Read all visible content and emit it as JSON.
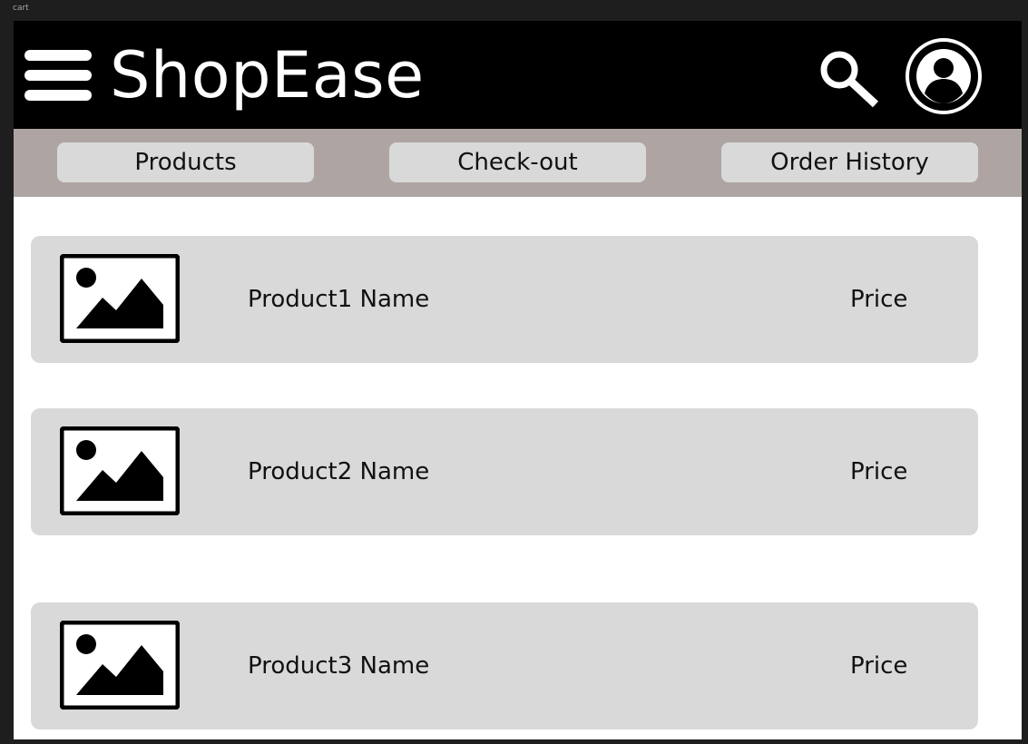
{
  "frame": {
    "label": "cart"
  },
  "header": {
    "brand": "ShopEase",
    "icons": {
      "menu": "hamburger-menu-icon",
      "search": "search-icon",
      "profile": "user-profile-icon"
    }
  },
  "nav": {
    "items": [
      {
        "label": "Products"
      },
      {
        "label": "Check-out"
      },
      {
        "label": "Order History"
      }
    ]
  },
  "cart": {
    "items": [
      {
        "name": "Product1 Name",
        "price": "Price",
        "image": "image-placeholder-icon"
      },
      {
        "name": "Product2 Name",
        "price": "Price",
        "image": "image-placeholder-icon"
      },
      {
        "name": "Product3 Name",
        "price": "Price",
        "image": "image-placeholder-icon"
      }
    ]
  },
  "colors": {
    "header_bg": "#000000",
    "nav_bg": "#aea5a3",
    "button_bg": "#d9d9d9",
    "row_bg": "#d9d9d9",
    "page_bg": "#ffffff",
    "canvas_bg": "#1e1e1e"
  }
}
